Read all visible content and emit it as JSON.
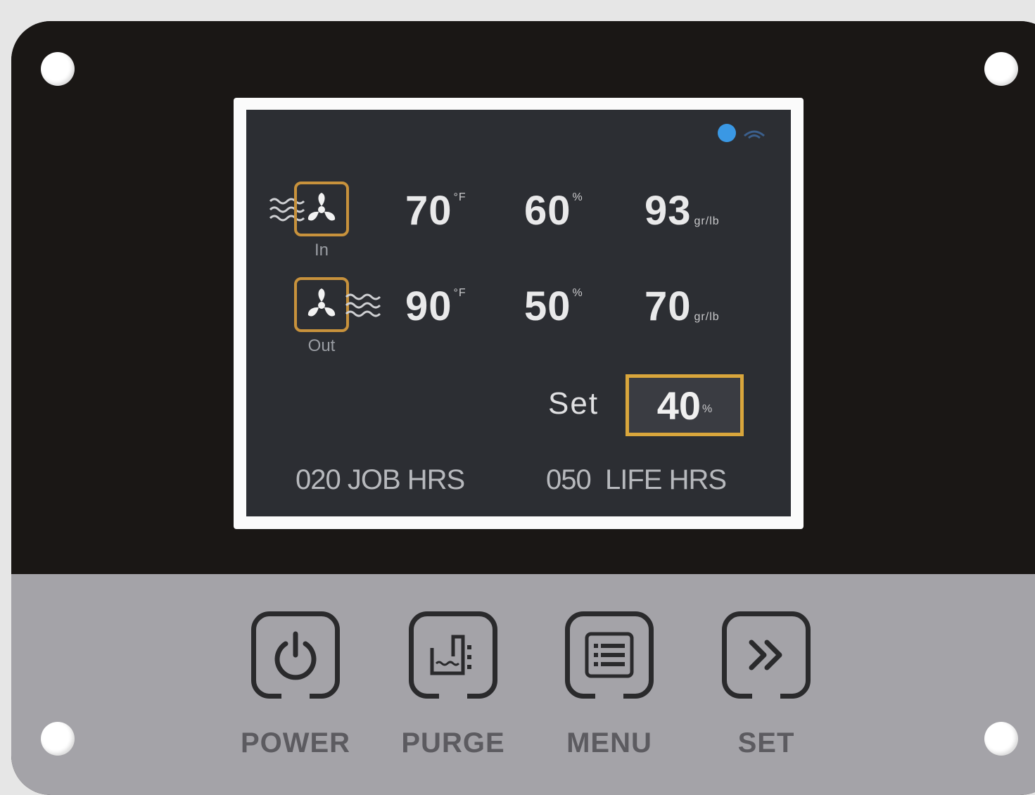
{
  "status": {
    "indicator_color": "#3a98e4",
    "icons": [
      "status-dot-icon",
      "wifi-icon"
    ]
  },
  "inlet": {
    "label": "In",
    "temperature": "70",
    "temperature_unit": "°F",
    "humidity": "60",
    "humidity_unit": "%",
    "grains": "93",
    "grains_unit": "gr/lb"
  },
  "outlet": {
    "label": "Out",
    "temperature": "90",
    "temperature_unit": "°F",
    "humidity": "50",
    "humidity_unit": "%",
    "grains": "70",
    "grains_unit": "gr/lb"
  },
  "setpoint": {
    "label": "Set",
    "value": "40",
    "unit": "%"
  },
  "hours": {
    "job_value": "020",
    "job_label": "JOB HRS",
    "life_value": "050",
    "life_label": "LIFE HRS"
  },
  "buttons": {
    "power": "POWER",
    "purge": "PURGE",
    "menu": "MENU",
    "set": "SET"
  },
  "colors": {
    "panel": "#1a1715",
    "screen": "#2c2e33",
    "accent": "#d9a63c",
    "keypad": "#a4a3a8"
  }
}
